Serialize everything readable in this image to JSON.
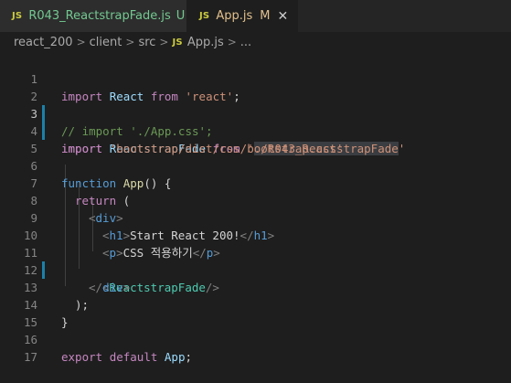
{
  "tabs": [
    {
      "icon_text": "JS",
      "label": "R043_ReactstrapFade.js",
      "status": "U"
    },
    {
      "icon_text": "JS",
      "label": "App.js",
      "status": "M",
      "close": "✕"
    }
  ],
  "breadcrumb": {
    "parts": [
      "react_200",
      "client",
      "src"
    ],
    "file_icon": "JS",
    "file": "App.js",
    "tail": "..."
  },
  "editor": {
    "line_numbers": [
      "1",
      "2",
      "3",
      "4",
      "5",
      "6",
      "7",
      "8",
      "9",
      "10",
      "11",
      "12",
      "13",
      "14",
      "15",
      "16",
      "17"
    ],
    "modified_lines": [
      2,
      3,
      11
    ],
    "code": {
      "l1": [
        "import",
        " ",
        "React",
        " ",
        "from",
        " ",
        "'react'",
        ";"
      ],
      "l2": [
        "// import './App.css';"
      ],
      "l3": [
        "import",
        " ",
        "ReactstrapFade",
        " ",
        "from",
        " ",
        "'",
        "./R043_ReactstrapFade",
        "'"
      ],
      "l4": [
        "import",
        " ",
        "'bootstrap/dist/css/bootstrap.css'"
      ],
      "l6": [
        "function",
        " ",
        "App",
        "() {"
      ],
      "l7": [
        "return",
        " ("
      ],
      "l8": [
        "<",
        "div",
        ">"
      ],
      "l9": [
        "<",
        "h1",
        ">",
        "Start React 200!",
        "</",
        "h1",
        ">"
      ],
      "l10": [
        "<",
        "p",
        ">",
        "CSS 적용하기",
        "</",
        "p",
        ">"
      ],
      "l11": [
        "<",
        "ReactstrapFade",
        "/>"
      ],
      "l12": [
        "</",
        "div",
        ">"
      ],
      "l13": [
        ");"
      ],
      "l14": [
        "}"
      ],
      "l16": [
        "export",
        " ",
        "default",
        " ",
        "App",
        ";"
      ]
    }
  }
}
